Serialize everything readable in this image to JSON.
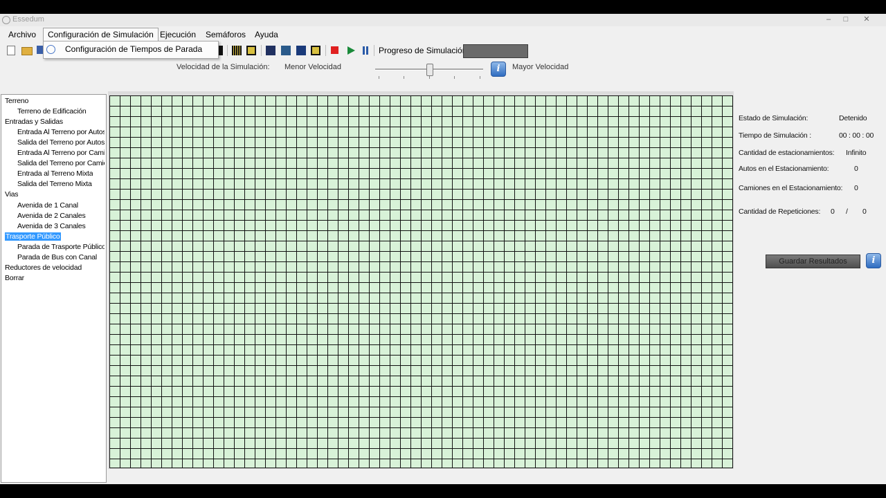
{
  "window": {
    "title": "Essedum"
  },
  "menu": [
    "Archivo",
    "Configuración de Simulación",
    "Ejecución",
    "Semáforos",
    "Ayuda"
  ],
  "dropdown": {
    "item": "Configuración de Tiempos de Parada"
  },
  "toolbar": {
    "progress_label": "Progreso de Simulación",
    "progress": 1.0
  },
  "speed": {
    "label": "Velocidad de la Simulación:",
    "min_label": "Menor Velocidad",
    "max_label": "Mayor Velocidad",
    "level": 0.5
  },
  "tree": [
    {
      "label": "Terreno",
      "level": 0
    },
    {
      "label": "Terreno de Edificación",
      "level": 1
    },
    {
      "label": "Entradas y Salidas",
      "level": 0
    },
    {
      "label": "Entrada Al Terreno por Autos",
      "level": 1
    },
    {
      "label": "Salida del Terreno por Autos",
      "level": 1
    },
    {
      "label": "Entrada Al Terreno por Camiones",
      "level": 1
    },
    {
      "label": "Salida del Terreno por Camiones",
      "level": 1
    },
    {
      "label": "Entrada al Terreno Mixta",
      "level": 1
    },
    {
      "label": "Salida del Terreno Mixta",
      "level": 1
    },
    {
      "label": "Vias",
      "level": 0
    },
    {
      "label": "Avenida de 1 Canal",
      "level": 1
    },
    {
      "label": "Avenida de 2 Canales",
      "level": 1
    },
    {
      "label": "Avenida de 3 Canales",
      "level": 1
    },
    {
      "label": "Trasporte Público",
      "level": 0,
      "selected": true
    },
    {
      "label": "Parada de Trasporte Público",
      "level": 1
    },
    {
      "label": "Parada de Bus con Canal",
      "level": 1
    },
    {
      "label": "Reductores de velocidad",
      "level": 0
    },
    {
      "label": "Borrar",
      "level": 0
    }
  ],
  "status": {
    "state_label": "Estado de Simulación:",
    "state_value": "Detenido",
    "time_label": "Tiempo de Simulación :",
    "time_value": "00 : 00 : 00",
    "parking_label": "Cantidad de estacionamientos:",
    "parking_value": "Infinito",
    "cars_label": "Autos en el Estacionamiento:",
    "cars_value": "0",
    "trucks_label": "Camiones en el Estacionamiento:",
    "trucks_value": "0",
    "reps_label": "Cantidad de Repeticiones:",
    "reps_current": "0",
    "reps_sep": "/",
    "reps_total": "0"
  },
  "save_button": "Guardar Resultados",
  "colors": {
    "grid_bg": "#d8f2d8",
    "selection": "#3399ff"
  }
}
